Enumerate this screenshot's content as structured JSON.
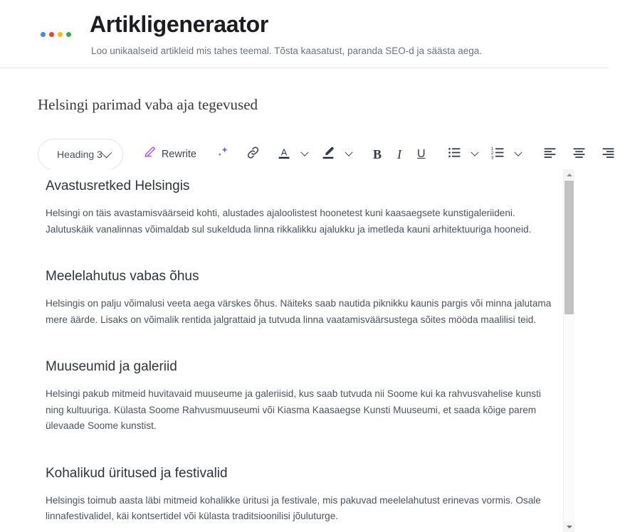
{
  "header": {
    "title": "Artikligeneraator",
    "subtitle": "Loo unikaalseid artikleid mis tahes teemal. Tõsta kaasatust, paranda SEO-d ja säästa aega.",
    "logo_dots": [
      {
        "name": "logo-dot-blue",
        "color": "#4285f4"
      },
      {
        "name": "logo-dot-red",
        "color": "#ea4335"
      },
      {
        "name": "logo-dot-yellow",
        "color": "#fbbc05"
      },
      {
        "name": "logo-dot-green",
        "color": "#34a853"
      }
    ]
  },
  "document": {
    "title": "Helsingi parimad vaba aja tegevused"
  },
  "toolbar": {
    "heading_select": {
      "value": "Heading 3",
      "icon": "chevron-down-icon"
    },
    "rewrite": {
      "label": "Rewrite",
      "icon": "pen-edit-icon",
      "color": "#a855f7"
    },
    "items": [
      {
        "name": "ai-sparkle-button",
        "icon": "sparkle-icon",
        "color": "#6366f1"
      },
      {
        "name": "insert-link-button",
        "icon": "link-icon",
        "color": "#3f4553"
      },
      {
        "name": "text-color-button",
        "icon": "text-color-icon",
        "color": "#333a47"
      },
      {
        "name": "text-color-dropdown",
        "icon": "chevron-down-icon",
        "color": "#3f4553"
      },
      {
        "name": "highlight-color-button",
        "icon": "highlighter-icon",
        "color": "#333a47"
      },
      {
        "name": "highlight-dropdown",
        "icon": "chevron-down-icon",
        "color": "#3f4553"
      },
      {
        "name": "bold-button",
        "icon": "bold-icon",
        "glyph": "B"
      },
      {
        "name": "italic-button",
        "icon": "italic-icon",
        "glyph": "I"
      },
      {
        "name": "underline-button",
        "icon": "underline-icon",
        "glyph": "U"
      },
      {
        "name": "bulleted-list-button",
        "icon": "bulleted-list-icon",
        "color": "#333a47"
      },
      {
        "name": "bulleted-list-dropdown",
        "icon": "chevron-down-icon",
        "color": "#3f4553"
      },
      {
        "name": "numbered-list-button",
        "icon": "numbered-list-icon",
        "color": "#333a47"
      },
      {
        "name": "numbered-list-dropdown",
        "icon": "chevron-down-icon",
        "color": "#3f4553"
      },
      {
        "name": "align-left-button",
        "icon": "align-left-icon",
        "color": "#333a47"
      },
      {
        "name": "align-center-button",
        "icon": "align-center-icon",
        "color": "#333a47"
      },
      {
        "name": "align-right-button",
        "icon": "align-right-icon",
        "color": "#333a47"
      }
    ]
  },
  "article": {
    "sections": [
      {
        "heading": "Avastusretked Helsingis",
        "paragraph": "Helsingi on täis avastamisväärseid kohti, alustades ajaloolistest hoonetest kuni kaasaegsete kunstigaleriideni. Jalutuskäik vanalinnas võimaldab sul sukelduda linna rikkalikku ajalukku ja imetleda kauni arhitektuuriga hooneid."
      },
      {
        "heading": "Meelelahutus vabas õhus",
        "paragraph": "Helsingis on palju võimalusi veeta aega värskes õhus. Näiteks saab nautida piknikku kaunis pargis või minna jalutama mere äärde. Lisaks on võimalik rentida jalgrattaid ja tutvuda linna vaatamisväärsustega sõites mööda maalilisi teid."
      },
      {
        "heading": "Muuseumid ja galeriid",
        "paragraph": "Helsingi pakub mitmeid huvitavaid muuseume ja galeriisid, kus saab tutvuda nii Soome kui ka rahvusvahelise kunsti ning kultuuriga. Külasta Soome Rahvusmuuseumi või Kiasma Kaasaegse Kunsti Muuseumi, et saada kõige parem ülevaade Soome kunstist."
      },
      {
        "heading": "Kohalikud üritused ja festivalid",
        "paragraph": "Helsingis toimub aasta läbi mitmeid kohalikke üritusi ja festivale, mis pakuvad meelelahutust erinevas vormis. Osale linnafestivalidel, käi kontsertidel või külasta traditsioonilisi jõuluturge."
      }
    ]
  },
  "scrollbar": {
    "up_icon": "scroll-up-arrow-icon",
    "down_icon": "scroll-down-arrow-icon"
  }
}
